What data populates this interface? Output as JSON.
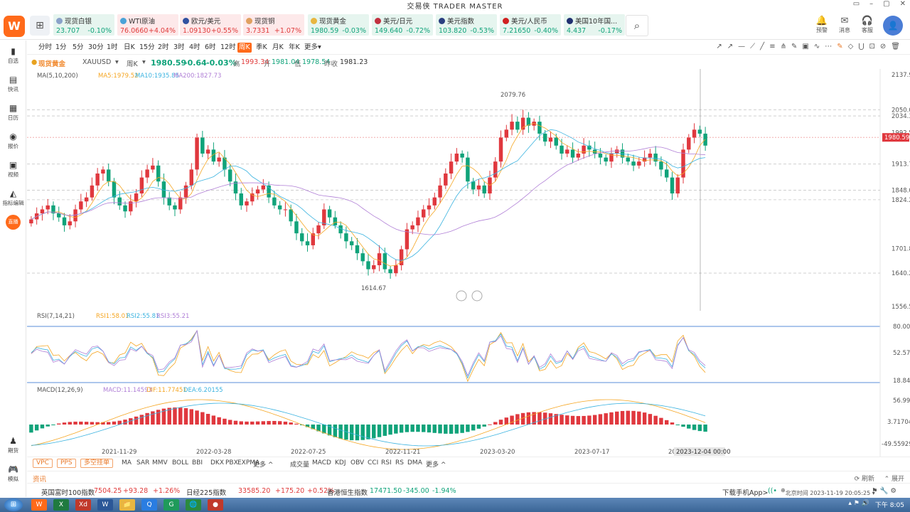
{
  "app": {
    "title": "交易侠  TRADER MASTER",
    "logo": "W"
  },
  "window_controls": [
    "▭",
    "–",
    "▢",
    "✕"
  ],
  "quotes": [
    {
      "name": "现货白银",
      "price": "23.707",
      "change": "-0.10%",
      "trend": "down",
      "dot_color": "#8aa2c9"
    },
    {
      "name": "WTI原油",
      "price": "76.0660",
      "change": "+4.04%",
      "trend": "up",
      "dot_color": "#4aa3d8"
    },
    {
      "name": "欧元/美元",
      "price": "1.09130",
      "change": "+0.55%",
      "trend": "up",
      "dot_color": "#3050a0"
    },
    {
      "name": "现货铜",
      "price": "3.7331",
      "change": "+1.07%",
      "trend": "up",
      "dot_color": "#e0a060"
    },
    {
      "name": "现货黄金",
      "price": "1980.59",
      "change": "-0.03%",
      "trend": "down",
      "dot_color": "#e8b640"
    },
    {
      "name": "美元/日元",
      "price": "149.640",
      "change": "-0.72%",
      "trend": "down",
      "dot_color": "#c23040"
    },
    {
      "name": "美元指数",
      "price": "103.820",
      "change": "-0.53%",
      "trend": "down",
      "dot_color": "#2a3f80"
    },
    {
      "name": "美元/人民币",
      "price": "7.21650",
      "change": "-0.40%",
      "trend": "down",
      "dot_color": "#d02020"
    },
    {
      "name": "美国10年国...",
      "price": "4.437",
      "change": "-0.17%",
      "trend": "down",
      "dot_color": "#203070"
    }
  ],
  "top_right": [
    {
      "icon": "bell-icon",
      "glyph": "🔔",
      "label": "预警"
    },
    {
      "icon": "mail-icon",
      "glyph": "✉",
      "label": "消息"
    },
    {
      "icon": "headset-icon",
      "glyph": "🎧",
      "label": "客服"
    }
  ],
  "avatar": "👤",
  "sidebar": [
    {
      "key": "watchlist",
      "glyph": "▮",
      "label": "自选"
    },
    {
      "key": "news",
      "glyph": "▤",
      "label": "快讯"
    },
    {
      "key": "calendar",
      "glyph": "▦",
      "label": "日历"
    },
    {
      "key": "quotes",
      "glyph": "◉",
      "label": "报价"
    },
    {
      "key": "video",
      "glyph": "▣",
      "label": "视频"
    },
    {
      "key": "indicator-edit",
      "glyph": "◭",
      "label": "指标编辑"
    },
    {
      "key": "futures",
      "glyph": "♟",
      "label": "期货"
    },
    {
      "key": "sim",
      "glyph": "🎮",
      "label": "模拟"
    }
  ],
  "sidebar_hot": "直播",
  "timeframes": [
    "分时",
    "1分",
    "5分",
    "30分",
    "1时",
    "日K",
    "15分",
    "2时",
    "3时",
    "4时",
    "6时",
    "12时",
    "周K",
    "季K",
    "月K",
    "年K",
    "更多▾"
  ],
  "active_timeframe": "周K",
  "symbol": {
    "name": "现货黄金",
    "code": "XAUUSD",
    "period": "周K",
    "price": "1980.59",
    "change": "-0.64",
    "change_pct": "-0.03%",
    "high_label": "高",
    "high": "1993.34",
    "open_label": "开",
    "open": "1981.04",
    "low_label": "低",
    "low": "1978.54",
    "prev_label": "昨收",
    "prev": "1981.23"
  },
  "ma_legend": {
    "name": "MA(5,10,200)",
    "ma5": "MA5:1979.52",
    "ma10": "MA10:1935.85",
    "ma200": "MA200:1827.73"
  },
  "rsi_legend": {
    "name": "RSI(7,14,21)",
    "rsi1": "RSI1:58.01",
    "rsi2": "RSI2:55.81",
    "rsi3": "RSI3:55.21"
  },
  "macd_legend": {
    "name": "MACD(12,26,9)",
    "macd": "MACD:11.14593",
    "dif": "DIF:11.77451",
    "dea": "DEA:6.20155"
  },
  "price_axis": [
    "2137.90",
    "2050.00",
    "2034.37",
    "1992.56",
    "1913.72",
    "1848.03",
    "1824.24",
    "1701.87",
    "1640.28",
    "1556.53"
  ],
  "current_price_tag": "1980.59",
  "rsi_axis": [
    "80.00",
    "52.57",
    "18.84"
  ],
  "macd_axis": [
    "56.99",
    "3.71704",
    "-49.55929"
  ],
  "annotations": {
    "high": "2079.76",
    "low": "1614.67"
  },
  "x_axis": [
    "2021-11-29",
    "2022-03-28",
    "2022-07-25",
    "2022-11-21",
    "2023-03-20",
    "2023-07-17",
    "20"
  ],
  "cursor_date": "2023-12-04 00:00",
  "indicator_tabs_left": [
    "VPC",
    "PPS",
    "多空挂单"
  ],
  "indicator_tabs_main": [
    "MA",
    "SAR",
    "MMV",
    "BOLL",
    "BBI",
    "DKX",
    "PBX",
    "EXPMA",
    "更多 ^"
  ],
  "indicator_tabs_sub": [
    "成交量",
    "MACD",
    "KDJ",
    "OBV",
    "CCI",
    "RSI",
    "RS",
    "DMA",
    "更多 ^"
  ],
  "news": {
    "label": "资讯",
    "refresh": "刷新",
    "expand": "展开"
  },
  "tickers": [
    {
      "name": "英国富时100指数",
      "price": "7504.25",
      "change": "+93.28",
      "pct": "+1.26%",
      "trend": "up"
    },
    {
      "name": "日经225指数",
      "price": "33585.20",
      "change": "+175.20",
      "pct": "+0.52%",
      "trend": "up"
    },
    {
      "name": "香港恒生指数",
      "price": "17471.50",
      "change": "-345.00",
      "pct": "-1.94%",
      "trend": "down"
    }
  ],
  "status_right": {
    "download": "下载手机App>",
    "time": "北京时间 2023-11-19 20:05:25 ▾"
  },
  "taskbar": {
    "clock": "下午 8:05",
    "apps": [
      "W",
      "X",
      "Xd",
      "W",
      "📁",
      "Q",
      "G",
      "🌐",
      "●"
    ]
  }
}
